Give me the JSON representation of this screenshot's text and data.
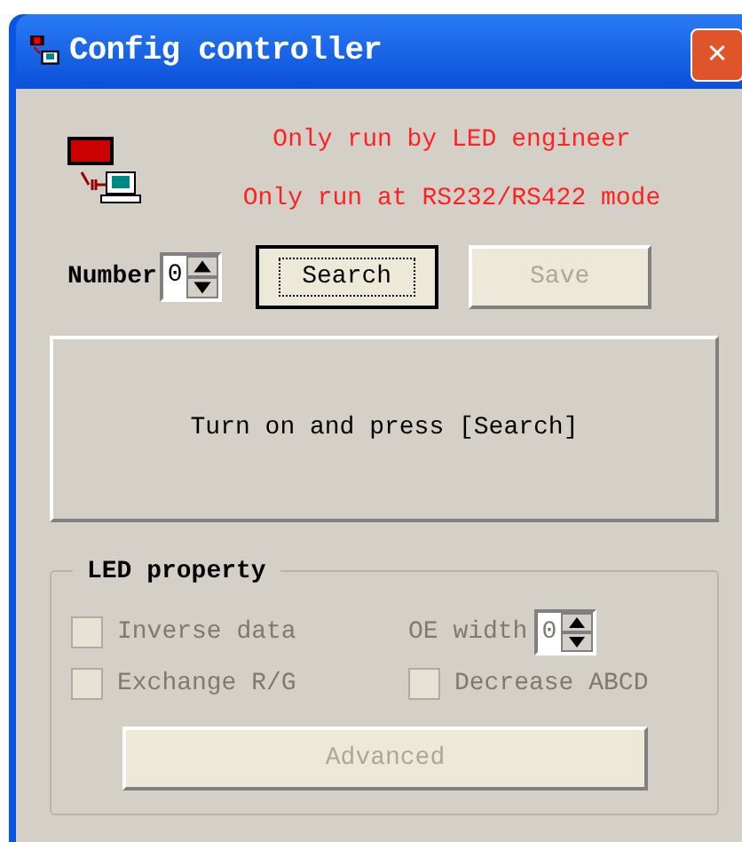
{
  "window": {
    "title": "Config controller",
    "close": "✕"
  },
  "notices": [
    "Only run by LED engineer",
    "Only run at RS232/RS422 mode"
  ],
  "number": {
    "label": "Number",
    "value": "0"
  },
  "buttons": [
    {
      "label": "Search",
      "disabled": false,
      "focused": true
    },
    {
      "label": "Save",
      "disabled": true,
      "focused": false
    }
  ],
  "status": "Turn on and press [Search]",
  "led_property": {
    "title": "LED property",
    "options": [
      {
        "label": "Inverse data",
        "checked": false,
        "disabled": true
      },
      {
        "label": "Exchange R/G",
        "checked": false,
        "disabled": true
      },
      {
        "label": "Decrease ABCD",
        "checked": false,
        "disabled": true
      }
    ],
    "oe_width": {
      "label": "OE width",
      "value": "0",
      "disabled": true
    },
    "advanced": {
      "label": "Advanced",
      "disabled": true
    }
  }
}
